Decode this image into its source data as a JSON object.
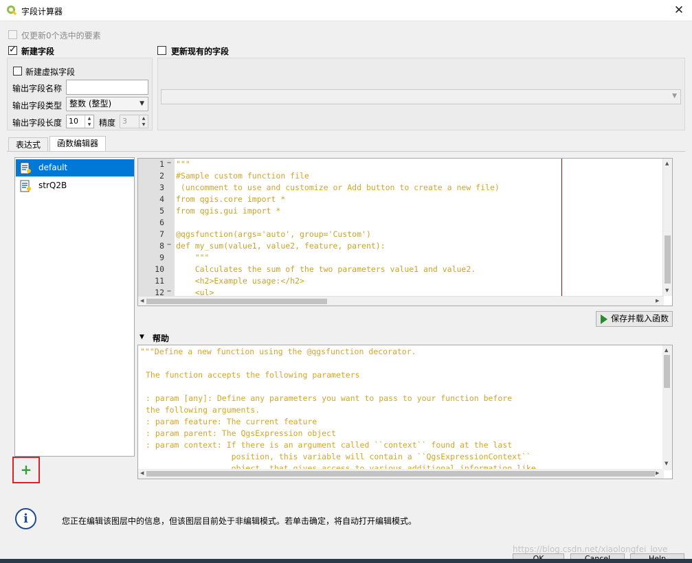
{
  "window": {
    "title": "字段计算器",
    "close": "✕"
  },
  "options": {
    "only_selected": "仅更新0个选中的要素",
    "new_field": "新建字段",
    "update_existing": "更新现有的字段",
    "virtual_field": "新建虚拟字段",
    "output_name_label": "输出字段名称",
    "output_name_value": "",
    "output_type_label": "输出字段类型",
    "output_type_value": "整数 (整型)",
    "output_length_label": "输出字段长度",
    "output_length_value": "10",
    "precision_label": "精度",
    "precision_value": "3",
    "existing_field_value": ""
  },
  "tabs": [
    {
      "label": "表达式",
      "active": false
    },
    {
      "label": "函数编辑器",
      "active": true
    }
  ],
  "function_files": [
    {
      "label": "default",
      "selected": true
    },
    {
      "label": "strQ2B",
      "selected": false
    }
  ],
  "add_button": "+",
  "editor": {
    "lines": [
      {
        "n": "1",
        "fold": "−",
        "text": "\"\"\""
      },
      {
        "n": "2",
        "fold": "",
        "text": "#Sample custom function file"
      },
      {
        "n": "3",
        "fold": "",
        "text": " (uncomment to use and customize or Add button to create a new file)"
      },
      {
        "n": "4",
        "fold": "",
        "text": "from qgis.core import *"
      },
      {
        "n": "5",
        "fold": "",
        "text": "from qgis.gui import *"
      },
      {
        "n": "6",
        "fold": "",
        "text": ""
      },
      {
        "n": "7",
        "fold": "",
        "text": "@qgsfunction(args='auto', group='Custom')"
      },
      {
        "n": "8",
        "fold": "−",
        "text": "def my_sum(value1, value2, feature, parent):"
      },
      {
        "n": "9",
        "fold": "",
        "text": "    \"\"\""
      },
      {
        "n": "10",
        "fold": "",
        "text": "    Calculates the sum of the two parameters value1 and value2."
      },
      {
        "n": "11",
        "fold": "",
        "text": "    <h2>Example usage:</h2>"
      },
      {
        "n": "12",
        "fold": "−",
        "text": "    <ul>"
      }
    ]
  },
  "save_button": "保存并载入函数",
  "help": {
    "title": "帮助",
    "toggle": "▼",
    "lines": [
      "\"\"\"Define a new function using the @qgsfunction decorator.",
      "",
      "The function accepts the following parameters",
      "",
      ": param [any]: Define any parameters you want to pass to your function before",
      "the following arguments.",
      ": param feature: The current feature",
      ": param parent: The QgsExpression object",
      ": param context: If there is an argument called ``context`` found at the last",
      "                  position, this variable will contain a ``QgsExpressionContext``",
      "                  object, that gives access to various additional information like"
    ]
  },
  "info_message": "您正在编辑该图层中的信息，但该图层目前处于非编辑模式。若单击确定，将自动打开编辑模式。",
  "buttons": {
    "ok": "OK",
    "cancel": "Cancel",
    "help": "Help"
  },
  "watermark": "https://blog.csdn.net/xiaolongfei_love",
  "colors": {
    "accent": "#0078d7",
    "code_text": "#c8a22e",
    "highlight_box": "#e02020"
  }
}
